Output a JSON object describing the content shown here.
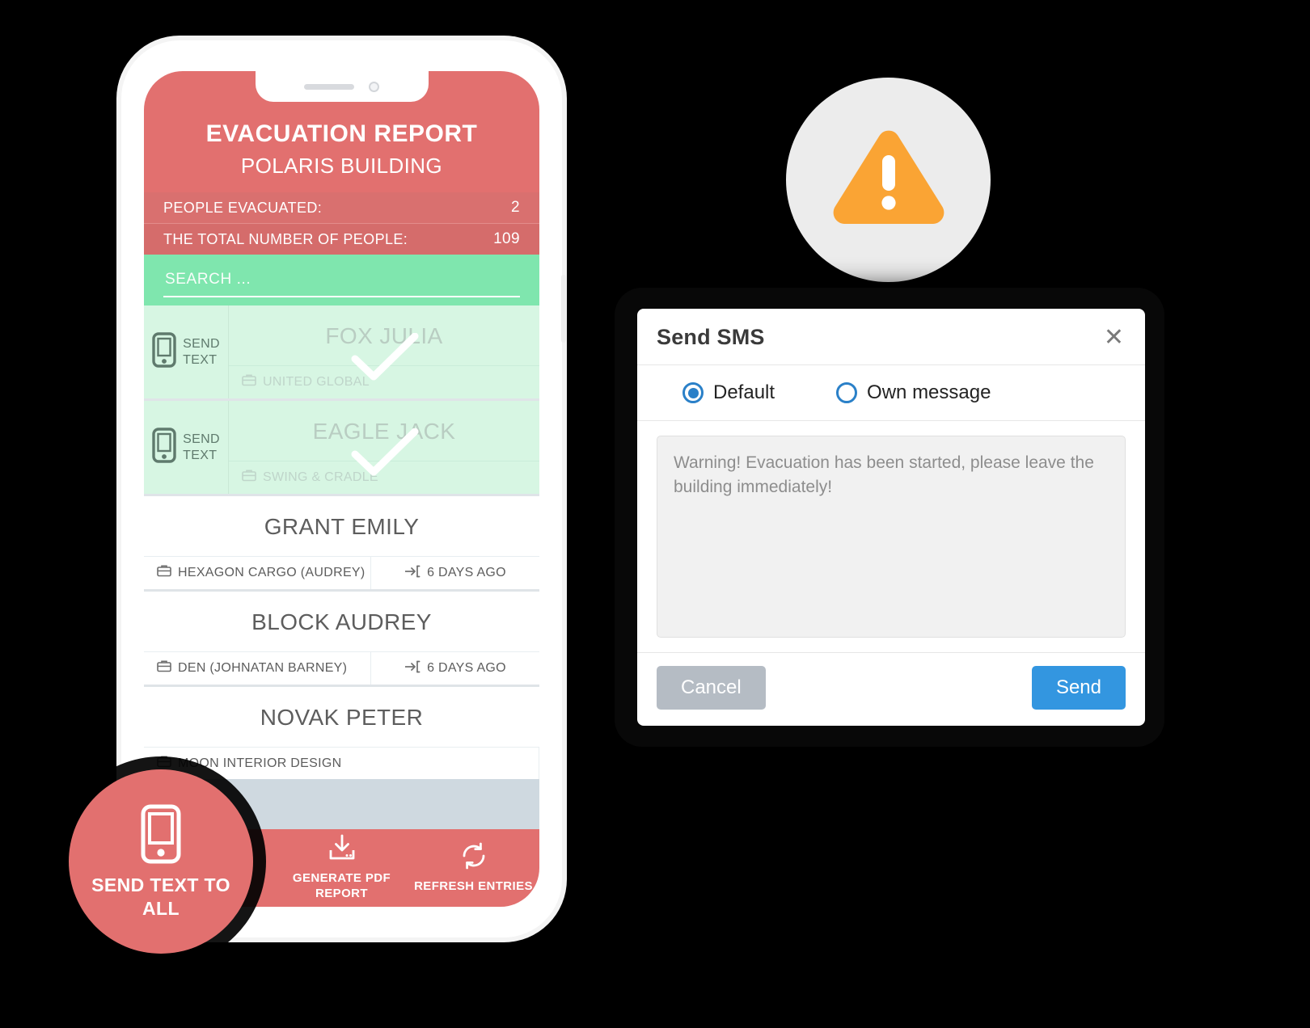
{
  "phone_app": {
    "header": {
      "title": "EVACUATION REPORT",
      "subtitle": "POLARIS BUILDING"
    },
    "stats": [
      {
        "label": "PEOPLE EVACUATED:",
        "value": "2"
      },
      {
        "label": "THE TOTAL NUMBER OF PEOPLE:",
        "value": "109"
      }
    ],
    "search": {
      "value": "",
      "placeholder": "SEARCH ..."
    },
    "entries": [
      {
        "name": "FOX JULIA",
        "company": "UNITED GLOBAL",
        "time": "",
        "evacuated": true,
        "send_text_label": "SEND\nTEXT"
      },
      {
        "name": "EAGLE JACK",
        "company": "SWING & CRADLE",
        "time": "",
        "evacuated": true,
        "send_text_label": "SEND\nTEXT"
      },
      {
        "name": "GRANT EMILY",
        "company": "HEXAGON CARGO  (AUDREY)",
        "time": "6 DAYS AGO",
        "evacuated": false,
        "send_text_label": ""
      },
      {
        "name": "BLOCK AUDREY",
        "company": "DEN  (JOHNATAN BARNEY)",
        "time": "6 DAYS AGO",
        "evacuated": false,
        "send_text_label": ""
      },
      {
        "name": "NOVAK PETER",
        "company": "MOON INTERIOR DESIGN",
        "time": "",
        "evacuated": false,
        "send_text_label": ""
      }
    ],
    "bottom_bar": [
      {
        "label": "GENERATE PDF REPORT",
        "icon": "download-tray-icon"
      },
      {
        "label": "REFRESH ENTRIES",
        "icon": "refresh-icon"
      }
    ],
    "send_all_badge": {
      "label": "SEND TEXT TO ALL",
      "icon": "mobile-phone-icon"
    }
  },
  "warning_icon": {
    "icon": "warning-triangle-icon",
    "circle_color": "#ececec",
    "triangle_color": "#faa434"
  },
  "sms_dialog": {
    "title": "Send SMS",
    "close_label": "✕",
    "options": [
      {
        "label": "Default",
        "selected": true
      },
      {
        "label": "Own message",
        "selected": false
      }
    ],
    "message": {
      "value": "",
      "placeholder": "Warning! Evacuation has been started, please leave the building immediately!"
    },
    "cancel_label": "Cancel",
    "send_label": "Send"
  },
  "colors": {
    "brand_red": "#e2706f",
    "stat_red": "#d9706f",
    "search_green": "#7fe6ae",
    "row_green": "#d7f6e3",
    "gap_gray": "#cfd9e0",
    "accent_blue": "#3396e0",
    "warning_orange": "#faa434"
  }
}
